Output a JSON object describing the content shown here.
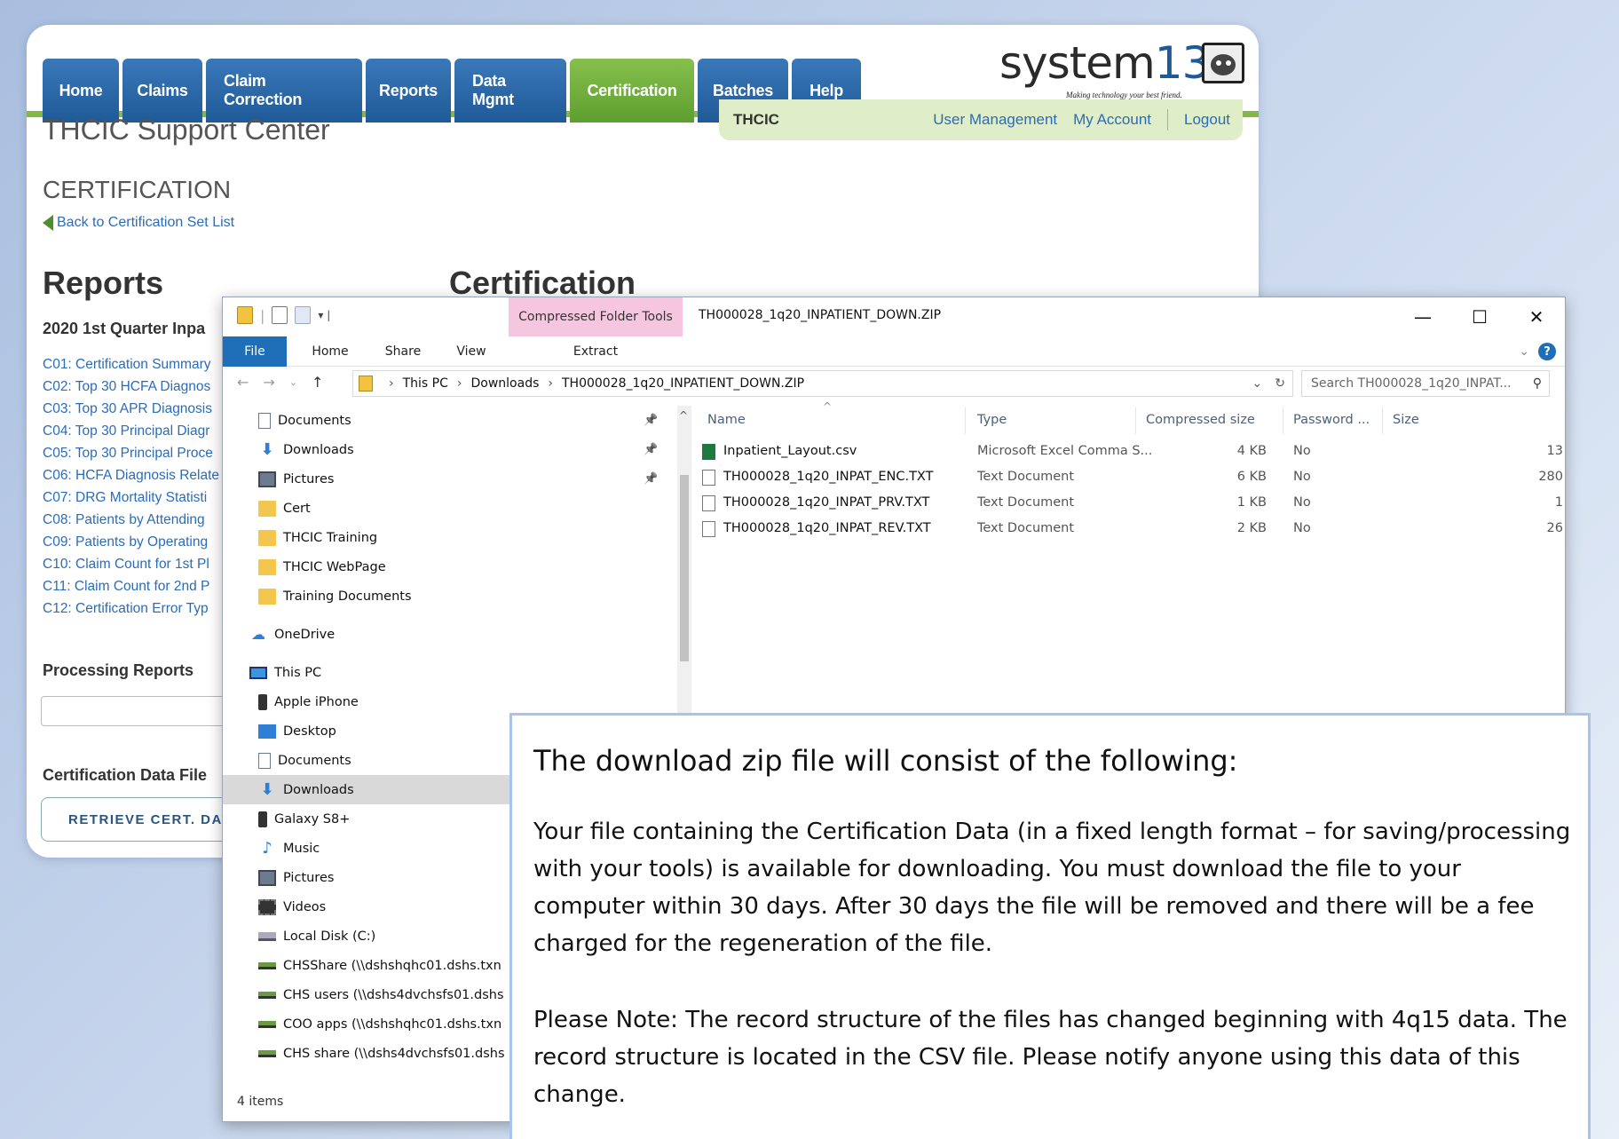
{
  "nav": {
    "tabs": [
      {
        "label": "Home"
      },
      {
        "label": "Claims"
      },
      {
        "label": "Claim Correction"
      },
      {
        "label": "Reports"
      },
      {
        "label": "Data Mgmt"
      },
      {
        "label": "Certification",
        "active": true
      },
      {
        "label": "Batches"
      },
      {
        "label": "Help"
      }
    ],
    "active_color": "#7bb443",
    "tab_color": "#2b6aa8"
  },
  "logo": {
    "brand": "system",
    "brand_num": "13",
    "tagline": "Making technology your best friend."
  },
  "userbar": {
    "org": "THCIC",
    "user_management": "User Management",
    "my_account": "My Account",
    "logout": "Logout"
  },
  "page": {
    "site_title": "THCIC Support Center",
    "section_title": "CERTIFICATION",
    "back_link": "Back to Certification Set List",
    "reports_heading": "Reports",
    "certification_heading": "Certification",
    "quarter_heading": "2020 1st Quarter Inpa",
    "report_links": [
      "C01: Certification Summary",
      "C02: Top 30 HCFA Diagnos",
      "C03: Top 30 APR Diagnosis",
      "C04: Top 30 Principal Diagr",
      "C05: Top 30 Principal Proce",
      "C06: HCFA Diagnosis Relate",
      "C07: DRG Mortality Statisti",
      "C08: Patients by Attending",
      "C09: Patients by Operating",
      "C10: Claim Count for 1st Pl",
      "C11: Claim Count for 2nd P",
      "C12: Certification Error Typ"
    ],
    "processing_heading": "Processing Reports",
    "cert_data_heading": "Certification Data File",
    "retrieve_button": "RETRIEVE CERT. DAT"
  },
  "explorer": {
    "context_tab": "Compressed Folder Tools",
    "title": "TH000028_1q20_INPATIENT_DOWN.ZIP",
    "ribbon_tabs": [
      "File",
      "Home",
      "Share",
      "View",
      "Extract"
    ],
    "breadcrumb": [
      "This PC",
      "Downloads",
      "TH000028_1q20_INPATIENT_DOWN.ZIP"
    ],
    "search_placeholder": "Search TH000028_1q20_INPAT...",
    "nav_items": [
      {
        "label": "Documents",
        "icon": "document-icon",
        "pinned": true
      },
      {
        "label": "Downloads",
        "icon": "download-icon",
        "pinned": true
      },
      {
        "label": "Pictures",
        "icon": "pictures-icon",
        "pinned": true
      },
      {
        "label": "Cert",
        "icon": "folder-icon"
      },
      {
        "label": "THCIC Training",
        "icon": "folder-icon"
      },
      {
        "label": "THCIC WebPage",
        "icon": "folder-icon"
      },
      {
        "label": "Training Documents",
        "icon": "folder-icon"
      },
      {
        "label": "OneDrive",
        "icon": "onedrive-icon",
        "top": true
      },
      {
        "label": "This PC",
        "icon": "this-pc-icon",
        "top": true
      },
      {
        "label": "Apple iPhone",
        "icon": "phone-icon"
      },
      {
        "label": "Desktop",
        "icon": "desktop-icon"
      },
      {
        "label": "Documents",
        "icon": "document-icon"
      },
      {
        "label": "Downloads",
        "icon": "download-icon",
        "selected": true
      },
      {
        "label": "Galaxy S8+",
        "icon": "phone-icon"
      },
      {
        "label": "Music",
        "icon": "music-icon"
      },
      {
        "label": "Pictures",
        "icon": "pictures-icon"
      },
      {
        "label": "Videos",
        "icon": "videos-icon"
      },
      {
        "label": "Local Disk (C:)",
        "icon": "disk-icon"
      },
      {
        "label": "CHSShare (\\\\dshshqhc01.dshs.txn",
        "icon": "network-drive-icon"
      },
      {
        "label": "CHS users (\\\\dshs4dvchsfs01.dshs",
        "icon": "network-drive-icon"
      },
      {
        "label": "COO apps (\\\\dshshqhc01.dshs.txn",
        "icon": "network-drive-icon"
      },
      {
        "label": "CHS share (\\\\dshs4dvchsfs01.dshs",
        "icon": "network-drive-icon"
      }
    ],
    "columns": [
      "Name",
      "Type",
      "Compressed size",
      "Password ...",
      "Size"
    ],
    "files": [
      {
        "name": "Inpatient_Layout.csv",
        "type": "Microsoft Excel Comma S...",
        "compressed": "4 KB",
        "password": "No",
        "size": "13",
        "icon": "excel-icon"
      },
      {
        "name": "TH000028_1q20_INPAT_ENC.TXT",
        "type": "Text Document",
        "compressed": "6 KB",
        "password": "No",
        "size": "280",
        "icon": "text-file-icon"
      },
      {
        "name": "TH000028_1q20_INPAT_PRV.TXT",
        "type": "Text Document",
        "compressed": "1 KB",
        "password": "No",
        "size": "1",
        "icon": "text-file-icon"
      },
      {
        "name": "TH000028_1q20_INPAT_REV.TXT",
        "type": "Text Document",
        "compressed": "2 KB",
        "password": "No",
        "size": "26",
        "icon": "text-file-icon"
      }
    ],
    "status": "4 items"
  },
  "callout": {
    "heading": "The download zip file will consist of the following:",
    "paragraph1": "Your file containing the Certification Data (in a fixed length format – for saving/processing with your tools) is available for downloading. You must download the file to your computer within 30 days. After 30 days the file will be removed and there will be a fee charged for the regeneration of the file.",
    "paragraph2": "Please Note: The record structure of the files has changed beginning with 4q15 data. The record structure is located in the CSV file. Please notify anyone using this data of this change."
  }
}
